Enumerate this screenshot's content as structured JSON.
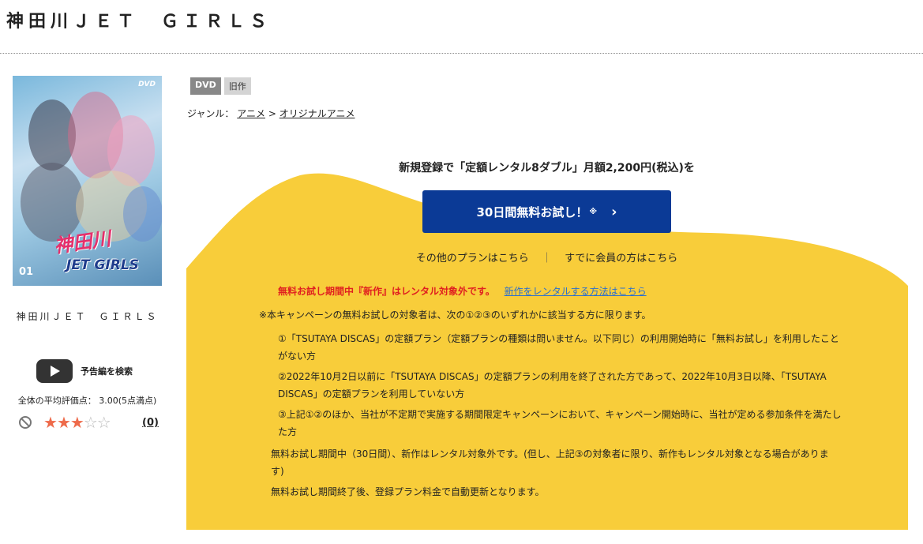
{
  "page": {
    "title": "神田川ＪＥＴ　ＧＩＲＬＳ"
  },
  "cover": {
    "dvd_mark": "DVD",
    "volume": "01",
    "logo_line1": "神田川",
    "logo_line2": "JET GIRLS"
  },
  "sidebar": {
    "title": "神田川ＪＥＴ　ＧＩＲＬＳ",
    "trailer_label": "予告編を検索",
    "avg_rating": "全体の平均評価点： 3.00(5点満点)",
    "rating_value": 3,
    "rating_max": 5,
    "review_count": "(0)",
    "star_filled": "★",
    "star_empty": "☆"
  },
  "badges": {
    "format": "DVD",
    "age": "旧作"
  },
  "genre": {
    "label": "ジャンル：",
    "category": "アニメ",
    "separator": ">",
    "subcategory": "オリジナルアニメ"
  },
  "campaign": {
    "headline": "新規登録で「定額レンタル8ダブル」月額2,200円(税込)を",
    "cta_label": "30日間無料お試し！",
    "cta_note": "※",
    "cta_chevron": "›",
    "other_plans": "その他のプランはこちら",
    "divider": "｜",
    "members": "すでに会員の方はこちら",
    "warning": "無料お試し期間中『新作』はレンタル対象外です。",
    "warning_link": "新作をレンタルする方法はこちら",
    "note_main": "※本キャンペーンの無料お試しの対象者は、次の①②③のいずれかに該当する方に限ります。",
    "conditions": [
      "①「TSUTAYA DISCAS」の定額プラン（定額プランの種類は問いません。以下同じ）の利用開始時に「無料お試し」を利用したことがない方",
      "②2022年10月2日以前に「TSUTAYA DISCAS」の定額プランの利用を終了された方であって、2022年10月3日以降、「TSUTAYA DISCAS」の定額プランを利用していない方",
      "③上記①②のほか、当社が不定期で実施する期間限定キャンペーンにおいて、キャンペーン開始時に、当社が定める参加条件を満たした方"
    ],
    "para1": "無料お試し期間中（30日間）、新作はレンタル対象外です。(但し、上記③の対象者に限り、新作もレンタル対象となる場合があります)",
    "para2": "無料お試し期間終了後、登録プラン料金で自動更新となります。"
  },
  "colors": {
    "accent_yellow": "#f8cd3a",
    "cta_blue": "#0b3a96",
    "warning_red": "#e02020",
    "link_blue": "#2a6ecf",
    "star_orange": "#ee6a4a"
  }
}
